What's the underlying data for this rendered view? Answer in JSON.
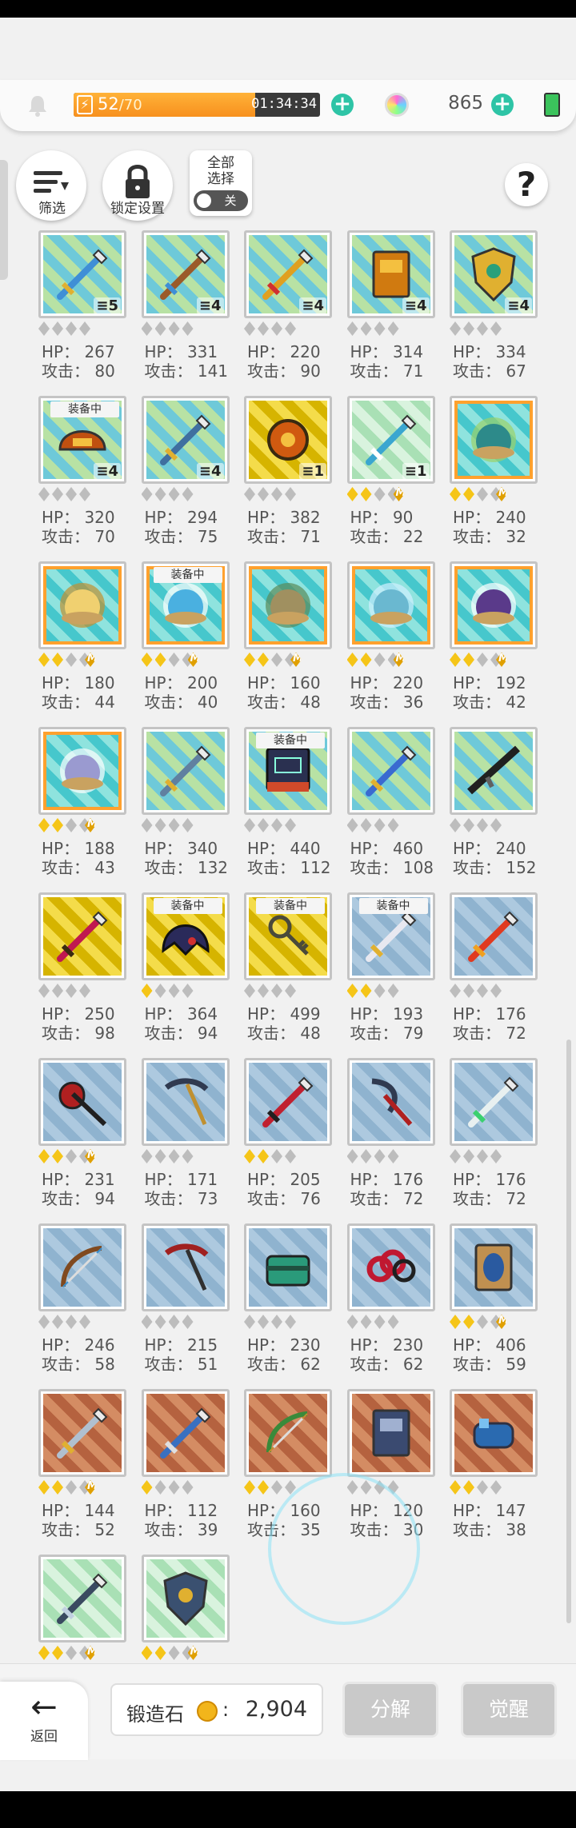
{
  "header": {
    "stamina_current": "52",
    "stamina_max": "/70",
    "timer": "01:34:34",
    "gems": "865"
  },
  "toolbar": {
    "filter_label": "筛选",
    "lock_settings_label": "锁定设置",
    "select_all_label": "全部\n选择",
    "toggle_label": "关",
    "help_label": "?"
  },
  "labels": {
    "hp_prefix": "HP：",
    "atk_prefix": "攻击：",
    "equipped": "装备中",
    "max": "MAX"
  },
  "items": [
    {
      "icon": "sword",
      "bg": "silver",
      "hp": "267",
      "atk": "80",
      "stars": 0,
      "count": "5",
      "color": "#3f8fd6",
      "accent": "#e0b030"
    },
    {
      "icon": "crossed-swords",
      "bg": "silver",
      "hp": "331",
      "atk": "141",
      "stars": 0,
      "count": "4",
      "color": "#9b5a2a",
      "accent": "#3f8fd6"
    },
    {
      "icon": "spear",
      "bg": "silver",
      "hp": "220",
      "atk": "90",
      "stars": 0,
      "count": "4",
      "color": "#e0a020",
      "accent": "#d03030"
    },
    {
      "icon": "book",
      "bg": "silver",
      "hp": "314",
      "atk": "71",
      "stars": 0,
      "count": "4",
      "color": "#d07a10",
      "accent": "#f4c040"
    },
    {
      "icon": "shield",
      "bg": "silver",
      "hp": "334",
      "atk": "67",
      "stars": 0,
      "count": "4",
      "color": "#e0b030",
      "accent": "#2aa07a"
    },
    {
      "icon": "helmet",
      "bg": "silver",
      "hp": "320",
      "atk": "70",
      "stars": 0,
      "count": "4",
      "equipped": true,
      "color": "#c05010",
      "accent": "#f4c040"
    },
    {
      "icon": "axe",
      "bg": "silver",
      "hp": "294",
      "atk": "75",
      "stars": 0,
      "count": "4",
      "color": "#3f6fa0",
      "accent": "#e0b030"
    },
    {
      "icon": "medallion",
      "bg": "gold",
      "hp": "382",
      "atk": "71",
      "stars": 0,
      "count": "1",
      "color": "#d05a10",
      "accent": "#3a2a10"
    },
    {
      "icon": "wand",
      "bg": "mint",
      "hp": "90",
      "atk": "22",
      "stars": 2,
      "max": true,
      "count": "1",
      "color": "#3aa6d0",
      "accent": "#ffffff"
    },
    {
      "icon": "orb",
      "bg": "orb",
      "hp": "240",
      "atk": "32",
      "stars": 2,
      "max": true,
      "color": "#2d8a8a",
      "accent": "#9bd26a"
    },
    {
      "icon": "orb",
      "bg": "orb",
      "hp": "180",
      "atk": "44",
      "stars": 2,
      "max": true,
      "color": "#f0d070",
      "accent": "#c09030"
    },
    {
      "icon": "orb",
      "bg": "orb",
      "hp": "200",
      "atk": "40",
      "stars": 2,
      "max": true,
      "equipped": true,
      "color": "#4ab0e0",
      "accent": "#ffffff"
    },
    {
      "icon": "orb",
      "bg": "orb",
      "hp": "160",
      "atk": "48",
      "stars": 2,
      "max": true,
      "color": "#a09060",
      "accent": "#5a8a5a"
    },
    {
      "icon": "orb",
      "bg": "orb",
      "hp": "220",
      "atk": "36",
      "stars": 2,
      "max": true,
      "color": "#6ab8d0",
      "accent": "#d0f0ff"
    },
    {
      "icon": "orb",
      "bg": "orb",
      "hp": "192",
      "atk": "42",
      "stars": 2,
      "max": true,
      "color": "#5a3a8a",
      "accent": "#ffffff"
    },
    {
      "icon": "orb",
      "bg": "orb",
      "hp": "188",
      "atk": "43",
      "stars": 2,
      "max": true,
      "color": "#9a9ad0",
      "accent": "#ffffff"
    },
    {
      "icon": "scepter",
      "bg": "silver",
      "hp": "340",
      "atk": "132",
      "stars": 0,
      "color": "#6080a0",
      "accent": "#e0b030"
    },
    {
      "icon": "terminal",
      "bg": "silver",
      "hp": "440",
      "atk": "112",
      "stars": 0,
      "equipped": true,
      "color": "#2a3050",
      "accent": "#d04a2a"
    },
    {
      "icon": "staff",
      "bg": "silver",
      "hp": "460",
      "atk": "108",
      "stars": 0,
      "color": "#3a6ad0",
      "accent": "#e0b030"
    },
    {
      "icon": "rifle",
      "bg": "silver",
      "hp": "240",
      "atk": "152",
      "stars": 0,
      "color": "#202020",
      "accent": "#606060"
    },
    {
      "icon": "mace",
      "bg": "gold",
      "hp": "250",
      "atk": "98",
      "stars": 0,
      "color": "#c01850",
      "accent": "#3a2a10"
    },
    {
      "icon": "hood",
      "bg": "gold",
      "hp": "364",
      "atk": "94",
      "stars": 1,
      "equipped": true,
      "color": "#2a2a5a",
      "accent": "#d03030"
    },
    {
      "icon": "key",
      "bg": "gold",
      "hp": "499",
      "atk": "48",
      "stars": 0,
      "equipped": true,
      "color": "#4a4a3a",
      "accent": "#a0a080"
    },
    {
      "icon": "lance",
      "bg": "blue",
      "hp": "193",
      "atk": "79",
      "stars": 2,
      "equipped": true,
      "color": "#e8e8f0",
      "accent": "#e0b030"
    },
    {
      "icon": "flame-sword",
      "bg": "blue",
      "hp": "176",
      "atk": "72",
      "stars": 0,
      "color": "#e03a20",
      "accent": "#f0a020"
    },
    {
      "icon": "battle-axe",
      "bg": "blue",
      "hp": "231",
      "atk": "94",
      "stars": 2,
      "max": true,
      "color": "#b02020",
      "accent": "#202020"
    },
    {
      "icon": "pickaxe",
      "bg": "blue",
      "hp": "171",
      "atk": "73",
      "stars": 0,
      "color": "#303a50",
      "accent": "#c09030"
    },
    {
      "icon": "trident",
      "bg": "blue",
      "hp": "205",
      "atk": "76",
      "stars": 2,
      "color": "#c02030",
      "accent": "#202020"
    },
    {
      "icon": "scythe",
      "bg": "blue",
      "hp": "176",
      "atk": "72",
      "stars": 0,
      "color": "#303a50",
      "accent": "#b02020"
    },
    {
      "icon": "light-spear",
      "bg": "blue",
      "hp": "176",
      "atk": "72",
      "stars": 0,
      "color": "#e8f0f0",
      "accent": "#3ad070"
    },
    {
      "icon": "crossbow",
      "bg": "blue",
      "hp": "246",
      "atk": "58",
      "stars": 0,
      "color": "#804a20",
      "accent": "#3a90d0"
    },
    {
      "icon": "pickaxe",
      "bg": "blue",
      "hp": "215",
      "atk": "51",
      "stars": 0,
      "color": "#a02020",
      "accent": "#303030"
    },
    {
      "icon": "chest",
      "bg": "blue",
      "hp": "230",
      "atk": "62",
      "stars": 0,
      "color": "#2a9a7a",
      "accent": "#205040"
    },
    {
      "icon": "chain",
      "bg": "blue",
      "hp": "230",
      "atk": "62",
      "stars": 0,
      "color": "#c01830",
      "accent": "#202020"
    },
    {
      "icon": "scroll",
      "bg": "blue",
      "hp": "406",
      "atk": "59",
      "stars": 2,
      "max": true,
      "color": "#2a5aa0",
      "accent": "#c09050"
    },
    {
      "icon": "greatsword",
      "bg": "bronze",
      "hp": "144",
      "atk": "52",
      "stars": 2,
      "max": true,
      "color": "#b0c0d0",
      "accent": "#e0b030"
    },
    {
      "icon": "spear",
      "bg": "bronze",
      "hp": "112",
      "atk": "39",
      "stars": 1,
      "color": "#3a70c0",
      "accent": "#e0e0e0"
    },
    {
      "icon": "bow",
      "bg": "bronze",
      "hp": "160",
      "atk": "35",
      "stars": 2,
      "color": "#3a8a3a",
      "accent": "#c09030"
    },
    {
      "icon": "tome",
      "bg": "bronze",
      "hp": "120",
      "atk": "30",
      "stars": 0,
      "color": "#3a4a70",
      "accent": "#a0b0d0"
    },
    {
      "icon": "gauntlet",
      "bg": "bronze",
      "hp": "147",
      "atk": "38",
      "stars": 2,
      "color": "#2a6ab0",
      "accent": "#303040"
    },
    {
      "icon": "dagger",
      "bg": "mint",
      "hp": "",
      "atk": "",
      "stars": 2,
      "max": true,
      "color": "#3a4a60",
      "accent": "#c0d0e0"
    },
    {
      "icon": "shield",
      "bg": "mint",
      "hp": "",
      "atk": "",
      "stars": 2,
      "max": true,
      "color": "#3a5070",
      "accent": "#e0b030"
    }
  ],
  "footer": {
    "back_label": "返回",
    "stone_label": "锻造石",
    "stone_colon": ":",
    "stone_value": "2,904",
    "decompose_label": "分解",
    "awaken_label": "觉醒"
  },
  "colors": {
    "accent": "#2ec4a6",
    "stamina": "#f7901e",
    "star_on": "#f5c518",
    "star_off": "#bdbdbd"
  }
}
